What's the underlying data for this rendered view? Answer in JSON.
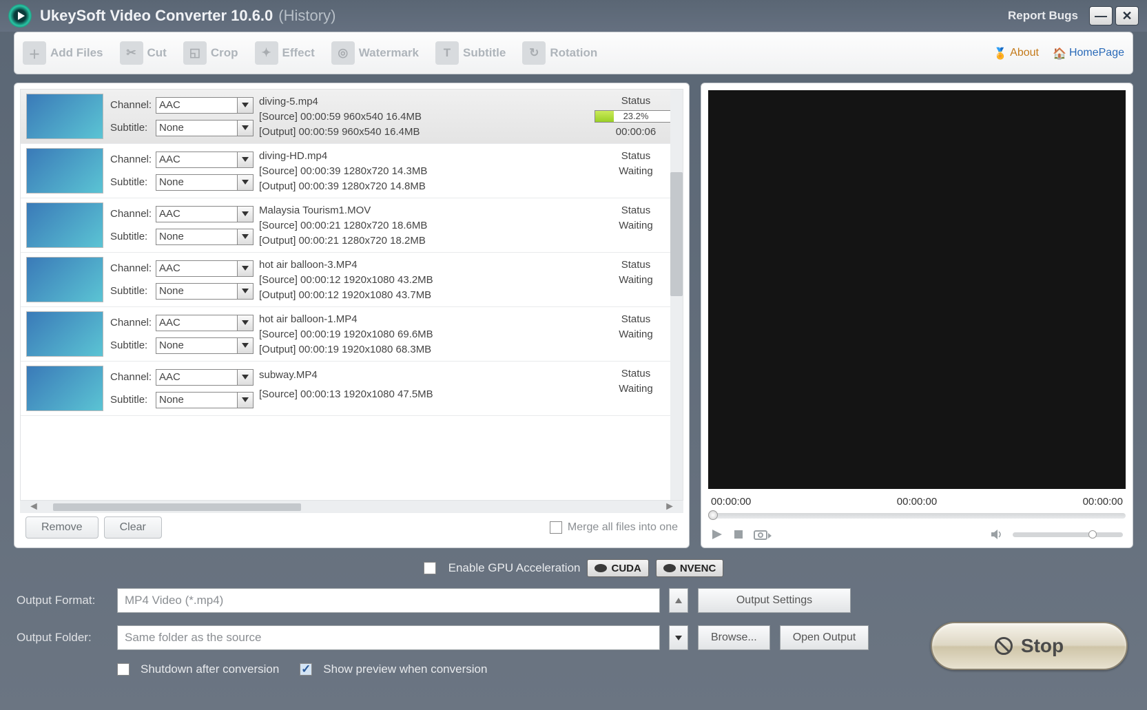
{
  "titlebar": {
    "app": "UkeySoft Video Converter 10.6.0",
    "history": "(History)",
    "report": "Report Bugs"
  },
  "toolbar": {
    "addfiles": "Add Files",
    "cut": "Cut",
    "crop": "Crop",
    "effect": "Effect",
    "watermark": "Watermark",
    "subtitle": "Subtitle",
    "rotation": "Rotation",
    "about": "About",
    "homepage": "HomePage"
  },
  "list": {
    "channel_label": "Channel:",
    "subtitle_label": "Subtitle:",
    "status_label": "Status",
    "remove": "Remove",
    "clear": "Clear",
    "merge": "Merge all files into one",
    "items": [
      {
        "channel": "AAC",
        "subtitle": "None",
        "name": "diving-5.mp4",
        "src": "[Source]  00:00:59  960x540  16.4MB",
        "out": "[Output]  00:00:59  960x540  16.4MB",
        "progress": "23.2%",
        "progress_pct": 23.2,
        "elapsed": "00:00:06",
        "active": true
      },
      {
        "channel": "AAC",
        "subtitle": "None",
        "name": "diving-HD.mp4",
        "src": "[Source]  00:00:39  1280x720  14.3MB",
        "out": "[Output]  00:00:39  1280x720  14.8MB",
        "status": "Waiting"
      },
      {
        "channel": "AAC",
        "subtitle": "None",
        "name": "Malaysia Tourism1.MOV",
        "src": "[Source]  00:00:21  1280x720  18.6MB",
        "out": "[Output]  00:00:21  1280x720  18.2MB",
        "status": "Waiting"
      },
      {
        "channel": "AAC",
        "subtitle": "None",
        "name": "hot air balloon-3.MP4",
        "src": "[Source]  00:00:12  1920x1080  43.2MB",
        "out": "[Output]  00:00:12  1920x1080  43.7MB",
        "status": "Waiting"
      },
      {
        "channel": "AAC",
        "subtitle": "None",
        "name": "hot air balloon-1.MP4",
        "src": "[Source]  00:00:19  1920x1080  69.6MB",
        "out": "[Output]  00:00:19  1920x1080  68.3MB",
        "status": "Waiting"
      },
      {
        "channel": "AAC",
        "subtitle": "None",
        "name": "subway.MP4",
        "src": "[Source]  00:00:13  1920x1080  47.5MB",
        "out": "",
        "status": "Waiting"
      }
    ]
  },
  "preview": {
    "t1": "00:00:00",
    "t2": "00:00:00",
    "t3": "00:00:00"
  },
  "gpu": {
    "enable": "Enable GPU Acceleration",
    "cuda": "CUDA",
    "nvenc": "NVENC"
  },
  "output": {
    "format_label": "Output Format:",
    "format_value": "MP4 Video (*.mp4)",
    "folder_label": "Output Folder:",
    "folder_value": "Same folder as the source",
    "settings": "Output Settings",
    "browse": "Browse...",
    "open": "Open Output",
    "shutdown": "Shutdown after conversion",
    "showpreview": "Show preview when conversion",
    "stop": "Stop"
  }
}
